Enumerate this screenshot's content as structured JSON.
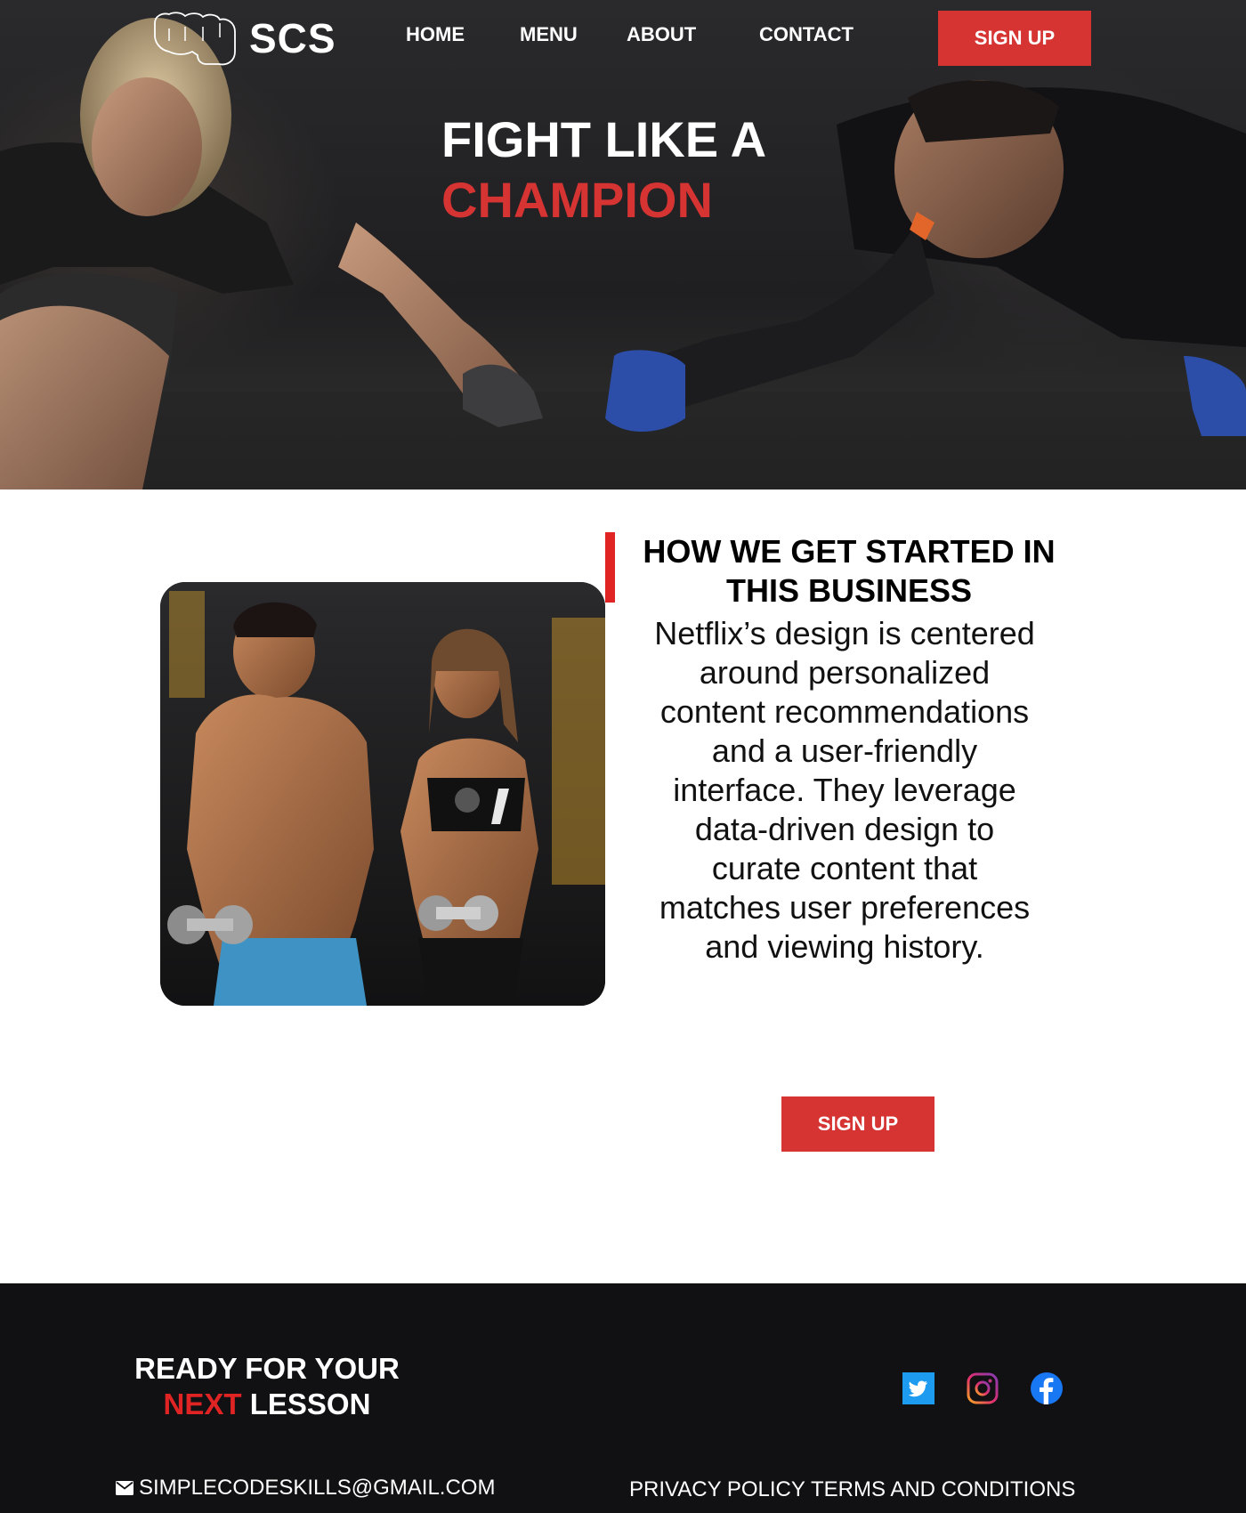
{
  "brand": {
    "name": "SCS",
    "logo_icon": "fist-icon"
  },
  "nav": {
    "home": "HOME",
    "menu": "MENU",
    "about": "ABOUT",
    "contact": "CONTACT",
    "signup": "SIGN UP"
  },
  "hero": {
    "title_line1": "FIGHT LIKE A",
    "title_line2": "CHAMPION"
  },
  "about": {
    "heading": "HOW WE GET STARTED IN THIS BUSINESS",
    "body": "Netflix’s design is centered around personalized content recommendations and a user-friendly interface. They leverage data-driven design to curate content that matches user preferences and viewing history.",
    "signup": "SIGN UP"
  },
  "footer": {
    "cta_line1": "READY FOR YOUR",
    "cta_next": "NEXT",
    "cta_lesson": "LESSON",
    "social": [
      "twitter-icon",
      "instagram-icon",
      "facebook-icon"
    ],
    "email": "SIMPLECODESKILLS@GMAIL.COM",
    "privacy": "PRIVACY POLICY",
    "terms": "TERMS AND CONDITIONS"
  },
  "colors": {
    "accent": "#d63333",
    "footer_bg": "#111013",
    "hero_bg": "#1f1f21"
  }
}
